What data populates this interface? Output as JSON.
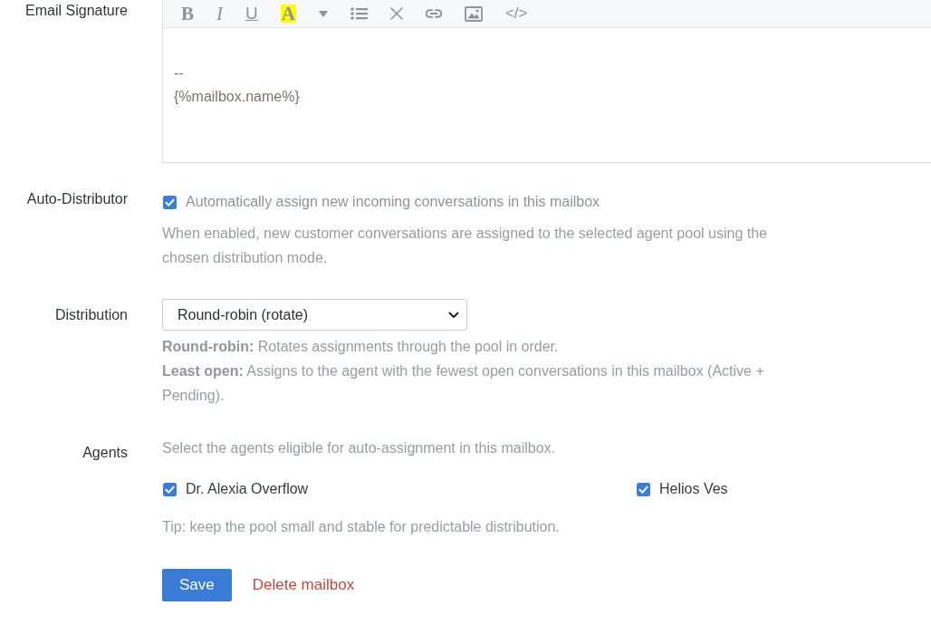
{
  "signature": {
    "label": "Email Signature",
    "toolbar": [
      {
        "kind": "bold",
        "label": "B"
      },
      {
        "kind": "italic",
        "label": "I"
      },
      {
        "kind": "underline",
        "label": "U"
      },
      {
        "kind": "highlight",
        "label": "A"
      },
      {
        "kind": "caret"
      },
      {
        "kind": "list"
      },
      {
        "kind": "clear"
      },
      {
        "kind": "link"
      },
      {
        "kind": "image"
      },
      {
        "kind": "code",
        "label": "</>"
      }
    ],
    "lines": [
      "--",
      "{%mailbox.name%}"
    ]
  },
  "auto_distributor": {
    "label": "Auto-Distributor",
    "checkbox": {
      "label": "Automatically assign new incoming conversations in this mailbox",
      "checked": true
    },
    "help": "When enabled, new customer conversations are assigned to the selected agent pool using the chosen distribution mode."
  },
  "distribution": {
    "label": "Distribution",
    "select": {
      "value": "Round-robin (rotate)"
    },
    "help": [
      "**Round-robin:** Rotates assignments through the pool in order.",
      "**Least open:** Assigns to the agent with the fewest open conversations in this mailbox (Active + Pending)."
    ]
  },
  "agents": {
    "label": "Agents",
    "description": "Select the agents eligible for auto-assignment in this mailbox.",
    "items": [
      {
        "name": "Dr. Alexia Overflow",
        "checked": true
      },
      {
        "name": "Helios Ves",
        "checked": true
      }
    ],
    "tip": "Tip: keep the pool small and stable for predictable distribution."
  },
  "actions": {
    "save": "Save",
    "delete": "Delete mailbox"
  }
}
